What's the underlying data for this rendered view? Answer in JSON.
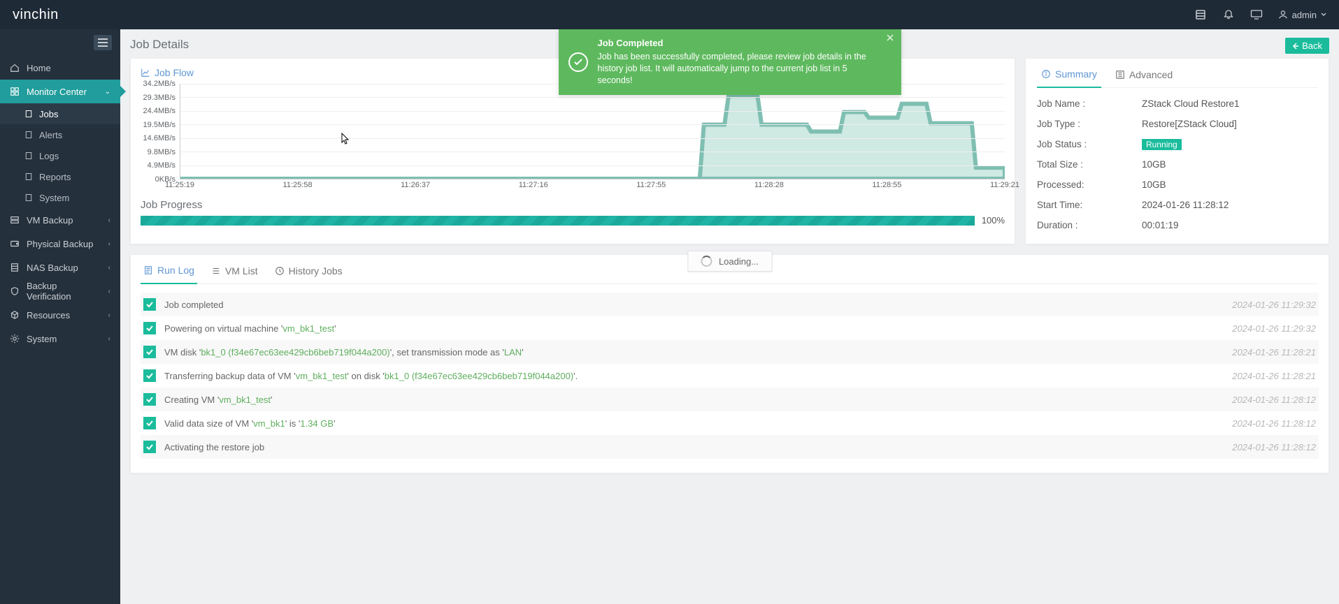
{
  "brand": {
    "a": "vin",
    "b": "chin"
  },
  "header": {
    "user_label": "admin"
  },
  "sidebar": {
    "home": "Home",
    "monitor": "Monitor Center",
    "sub": [
      "Jobs",
      "Alerts",
      "Logs",
      "Reports",
      "System"
    ],
    "vm": "VM Backup",
    "physical": "Physical Backup",
    "nas": "NAS Backup",
    "verify": "Backup Verification",
    "resources": "Resources",
    "system": "System"
  },
  "page_title": "Job Details",
  "back": "Back",
  "toast": {
    "title": "Job Completed",
    "body": "Job has been successfully completed, please review job details in the history job list. It will automatically jump to the current job list in 5 seconds!"
  },
  "flow_label": "Job Flow",
  "progress_label": "Job Progress",
  "progress_pct": "100%",
  "side_tabs": {
    "summary": "Summary",
    "advanced": "Advanced"
  },
  "summary": {
    "job_name_k": "Job Name :",
    "job_name_v": "ZStack Cloud Restore1",
    "job_type_k": "Job Type :",
    "job_type_v": "Restore[ZStack Cloud]",
    "job_status_k": "Job Status :",
    "job_status_v": "Running",
    "total_k": "Total Size :",
    "total_v": "10GB",
    "processed_k": "Processed:",
    "processed_v": "10GB",
    "start_k": "Start Time:",
    "start_v": "2024-01-26 11:28:12",
    "duration_k": "Duration :",
    "duration_v": "00:01:19"
  },
  "log_tabs": {
    "run": "Run Log",
    "vm": "VM List",
    "history": "History Jobs"
  },
  "loading": "Loading...",
  "logs": [
    {
      "msg": [
        [
          "",
          "Job completed"
        ]
      ],
      "ts": "2024-01-26 11:29:32"
    },
    {
      "msg": [
        [
          "",
          "Powering on virtual machine '"
        ],
        [
          "hl",
          "vm_bk1_test"
        ],
        [
          "",
          "'"
        ]
      ],
      "ts": "2024-01-26 11:29:32"
    },
    {
      "msg": [
        [
          "",
          "VM disk '"
        ],
        [
          "hl",
          "bk1_0 (f34e67ec63ee429cb6beb719f044a200)"
        ],
        [
          "",
          "', set transmission mode as '"
        ],
        [
          "hl",
          "LAN"
        ],
        [
          "",
          "'"
        ]
      ],
      "ts": "2024-01-26 11:28:21"
    },
    {
      "msg": [
        [
          "",
          "Transferring backup data of VM '"
        ],
        [
          "hl",
          "vm_bk1_test"
        ],
        [
          "",
          "' on disk '"
        ],
        [
          "hl",
          "bk1_0 (f34e67ec63ee429cb6beb719f044a200)"
        ],
        [
          "",
          "'."
        ]
      ],
      "ts": "2024-01-26 11:28:21"
    },
    {
      "msg": [
        [
          "",
          "Creating VM '"
        ],
        [
          "hl",
          "vm_bk1_test"
        ],
        [
          "",
          "'"
        ]
      ],
      "ts": "2024-01-26 11:28:12"
    },
    {
      "msg": [
        [
          "",
          "Valid data size of VM '"
        ],
        [
          "hl",
          "vm_bk1"
        ],
        [
          "",
          "' is '"
        ],
        [
          "hl",
          "1.34 GB"
        ],
        [
          "",
          "'"
        ]
      ],
      "ts": "2024-01-26 11:28:12"
    },
    {
      "msg": [
        [
          "",
          "Activating the restore job"
        ]
      ],
      "ts": "2024-01-26 11:28:12"
    }
  ],
  "chart_data": {
    "type": "area",
    "ylabel": "",
    "ylim": [
      0,
      34.2
    ],
    "y_ticks": [
      "34.2MB/s",
      "29.3MB/s",
      "24.4MB/s",
      "19.5MB/s",
      "14.6MB/s",
      "9.8MB/s",
      "4.9MB/s",
      "0KB/s"
    ],
    "x_ticks": [
      "11:25:19",
      "11:25:58",
      "11:26:37",
      "11:27:16",
      "11:27:55",
      "11:28:28",
      "11:28:55",
      "11:29:21"
    ],
    "x": [
      0,
      0.63,
      0.635,
      0.66,
      0.665,
      0.7,
      0.705,
      0.76,
      0.765,
      0.8,
      0.805,
      0.83,
      0.835,
      0.87,
      0.875,
      0.905,
      0.91,
      0.96,
      0.965,
      1.0
    ],
    "values": [
      0,
      0,
      19.5,
      19.5,
      30.0,
      30.0,
      19.5,
      19.5,
      17.0,
      17.0,
      24.0,
      24.0,
      22.0,
      22.0,
      27.0,
      27.0,
      20.0,
      20.0,
      4.0,
      4.0
    ]
  }
}
